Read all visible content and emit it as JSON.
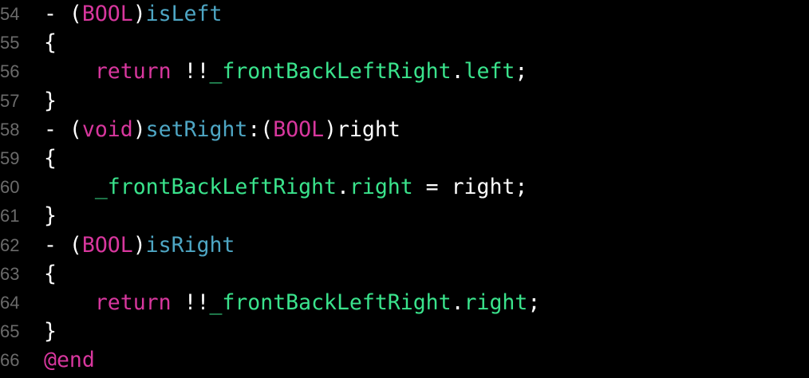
{
  "colors": {
    "background": "#000000",
    "plain": "#ffffff",
    "keyword": "#d8379e",
    "method": "#4ea6c4",
    "ivar": "#3ae38c",
    "line_number": "#6b6b6b"
  },
  "lines": [
    {
      "num": "54",
      "tokens": [
        {
          "t": "- (",
          "c": "plain"
        },
        {
          "t": "BOOL",
          "c": "keyword"
        },
        {
          "t": ")",
          "c": "plain"
        },
        {
          "t": "isLeft",
          "c": "method"
        }
      ]
    },
    {
      "num": "55",
      "tokens": [
        {
          "t": "{",
          "c": "plain"
        }
      ]
    },
    {
      "num": "56",
      "tokens": [
        {
          "t": "    ",
          "c": "plain"
        },
        {
          "t": "return",
          "c": "keyword"
        },
        {
          "t": " !!",
          "c": "plain"
        },
        {
          "t": "_frontBackLeftRight",
          "c": "ivar"
        },
        {
          "t": ".",
          "c": "plain"
        },
        {
          "t": "left",
          "c": "ivar"
        },
        {
          "t": ";",
          "c": "plain"
        }
      ]
    },
    {
      "num": "57",
      "tokens": [
        {
          "t": "}",
          "c": "plain"
        }
      ]
    },
    {
      "num": "58",
      "tokens": [
        {
          "t": "- (",
          "c": "plain"
        },
        {
          "t": "void",
          "c": "keyword"
        },
        {
          "t": ")",
          "c": "plain"
        },
        {
          "t": "setRight",
          "c": "method"
        },
        {
          "t": ":(",
          "c": "plain"
        },
        {
          "t": "BOOL",
          "c": "keyword"
        },
        {
          "t": ")right",
          "c": "plain"
        }
      ]
    },
    {
      "num": "59",
      "tokens": [
        {
          "t": "{",
          "c": "plain"
        }
      ]
    },
    {
      "num": "60",
      "tokens": [
        {
          "t": "    ",
          "c": "plain"
        },
        {
          "t": "_frontBackLeftRight",
          "c": "ivar"
        },
        {
          "t": ".",
          "c": "plain"
        },
        {
          "t": "right",
          "c": "ivar"
        },
        {
          "t": " = right;",
          "c": "plain"
        }
      ]
    },
    {
      "num": "61",
      "tokens": [
        {
          "t": "}",
          "c": "plain"
        }
      ]
    },
    {
      "num": "62",
      "tokens": [
        {
          "t": "- (",
          "c": "plain"
        },
        {
          "t": "BOOL",
          "c": "keyword"
        },
        {
          "t": ")",
          "c": "plain"
        },
        {
          "t": "isRight",
          "c": "method"
        }
      ]
    },
    {
      "num": "63",
      "tokens": [
        {
          "t": "{",
          "c": "plain"
        }
      ]
    },
    {
      "num": "64",
      "tokens": [
        {
          "t": "    ",
          "c": "plain"
        },
        {
          "t": "return",
          "c": "keyword"
        },
        {
          "t": " !!",
          "c": "plain"
        },
        {
          "t": "_frontBackLeftRight",
          "c": "ivar"
        },
        {
          "t": ".",
          "c": "plain"
        },
        {
          "t": "right",
          "c": "ivar"
        },
        {
          "t": ";",
          "c": "plain"
        }
      ]
    },
    {
      "num": "65",
      "tokens": [
        {
          "t": "}",
          "c": "plain"
        }
      ]
    },
    {
      "num": "66",
      "tokens": [
        {
          "t": "@end",
          "c": "keyword"
        }
      ]
    }
  ]
}
